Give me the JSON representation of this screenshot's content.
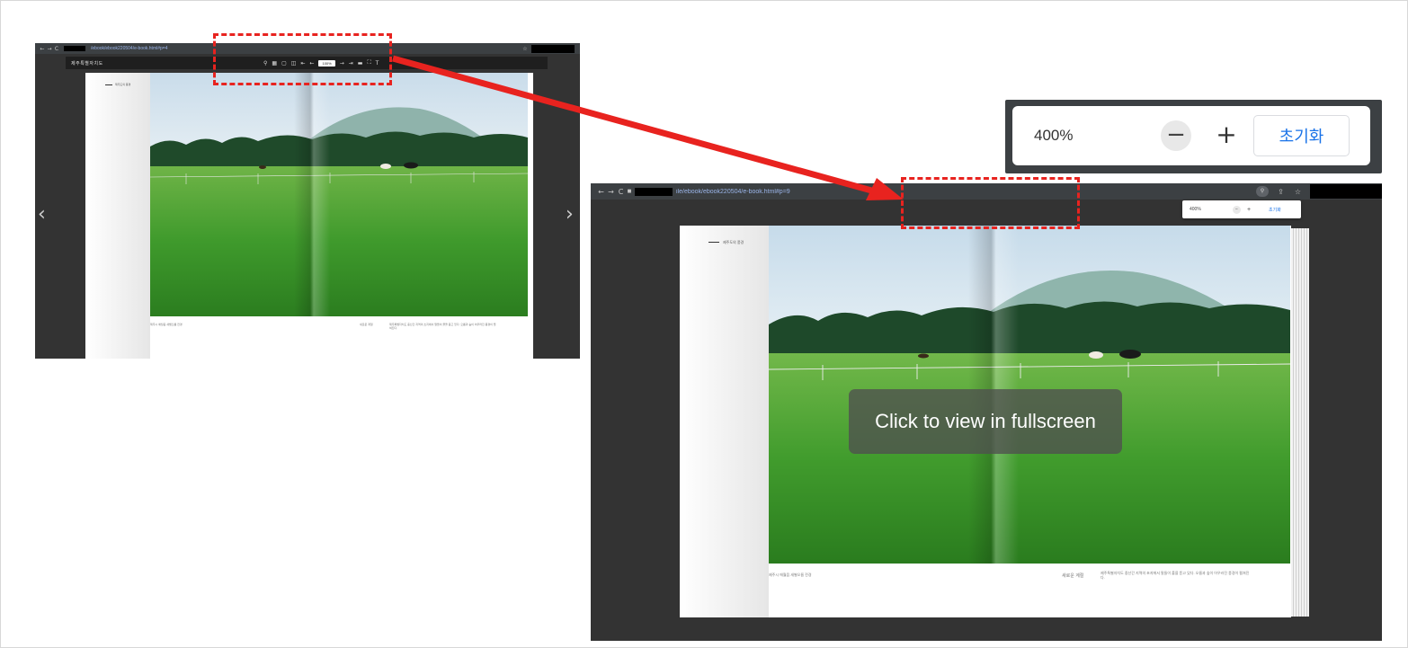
{
  "small_window": {
    "url": "/ebook/ebook220504/e-book.html#p=4",
    "viewer_logo": "제주특별자치도",
    "zoom_value": "100%",
    "page_label": "제주도의 풍경",
    "caption_left": "제주시 애월읍 새별오름 전경",
    "caption_title": "새로운 계절",
    "caption_body": "제주특별자치도 중산간 지역의 초지에서 말들이 풀을 뜯고 있다. 오름과 숲이 어우러진 풍경이 펼쳐진다."
  },
  "large_window": {
    "url": "ile/ebook/ebook220504/e-book.html#p=9",
    "popup_zoom": "400%",
    "popup_reset": "초기화",
    "page_label": "제주도의 풍경",
    "fullscreen_label": "Click to view in fullscreen",
    "caption_left": "제주시 애월읍 새별오름 전경",
    "caption_title": "새로운 계절",
    "caption_body": "제주특별자치도 중산간 지역의 초지에서 말들이 풀을 뜯고 있다. 오름과 숲이 어우러진 풍경이 펼쳐진다."
  },
  "zoom_callout": {
    "level": "400%",
    "minus": "−",
    "plus": "+",
    "reset": "초기화"
  },
  "icons": {
    "back": "←",
    "forward": "→",
    "reload": "C",
    "lock": "■",
    "star": "☆",
    "prev_page": "‹",
    "next_page": "›"
  },
  "colors": {
    "annotation_red": "#e8231f",
    "reset_blue": "#1a73e8",
    "viewer_bg": "#333333",
    "chrome_bg": "#3c4043"
  }
}
